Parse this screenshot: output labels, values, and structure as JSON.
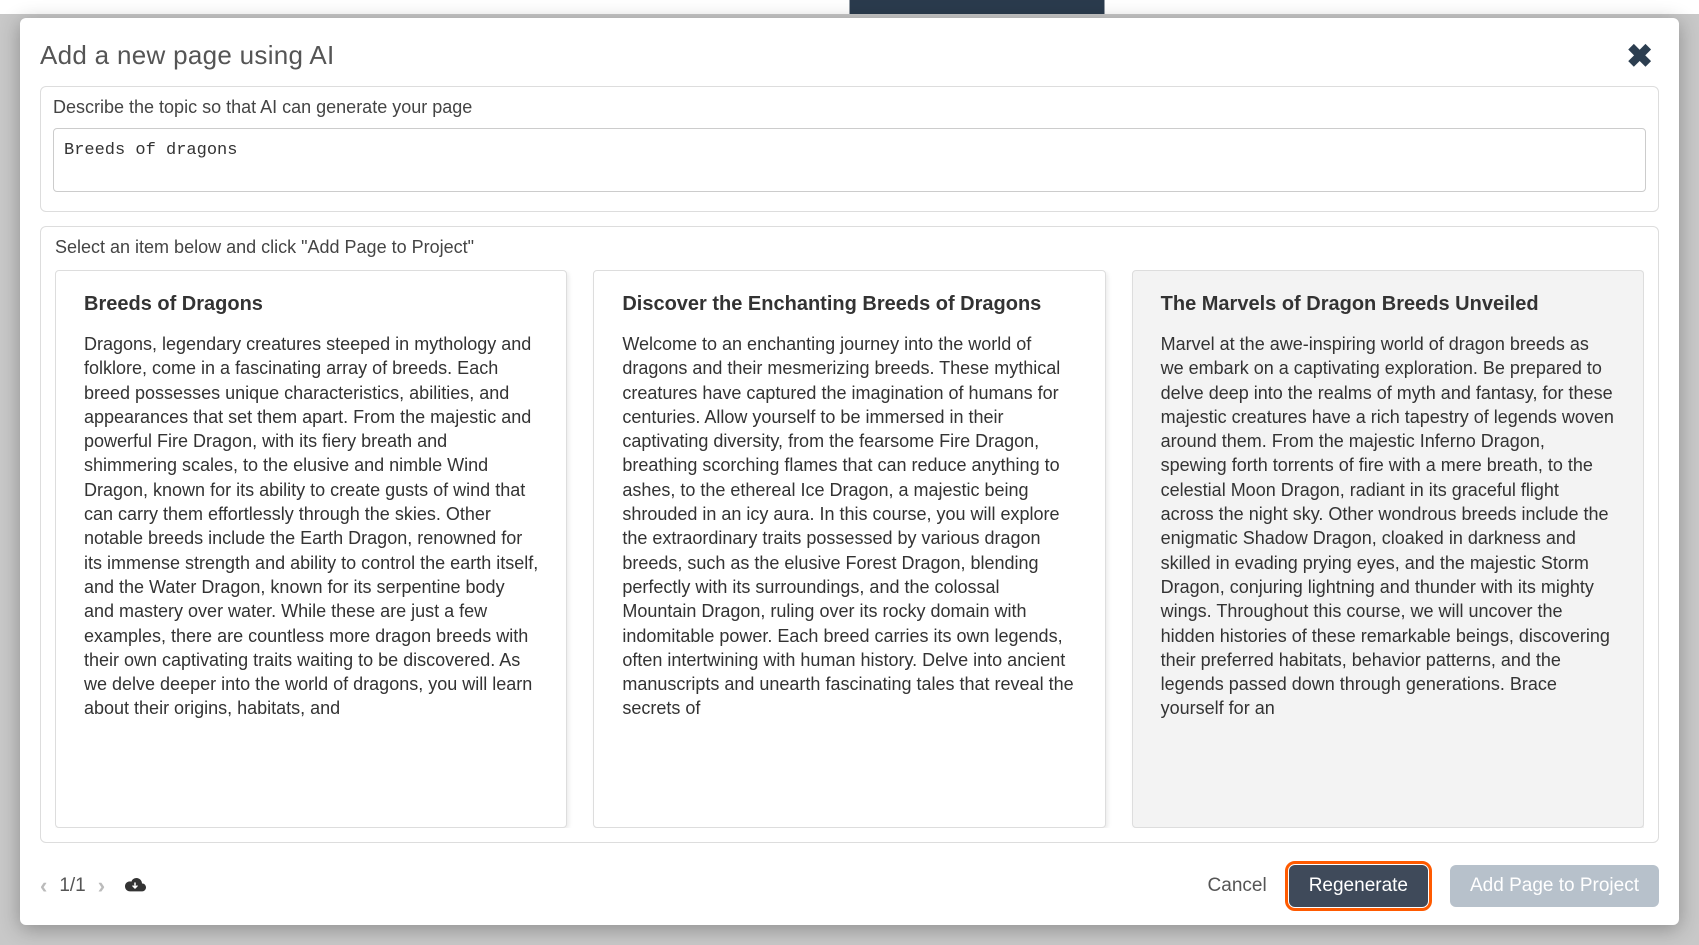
{
  "modal": {
    "title": "Add a new page using AI",
    "describe_label": "Describe the topic so that AI can generate your page",
    "describe_value": "Breeds of dragons",
    "select_label": "Select an item below and click \"Add Page to Project\""
  },
  "cards": [
    {
      "title": "Breeds of Dragons",
      "body": "Dragons, legendary creatures steeped in mythology and folklore, come in a fascinating array of breeds. Each breed possesses unique characteristics, abilities, and appearances that set them apart. From the majestic and powerful Fire Dragon, with its fiery breath and shimmering scales, to the elusive and nimble Wind Dragon, known for its ability to create gusts of wind that can carry them effortlessly through the skies. Other notable breeds include the Earth Dragon, renowned for its immense strength and ability to control the earth itself, and the Water Dragon, known for its serpentine body and mastery over water. While these are just a few examples, there are countless more dragon breeds with their own captivating traits waiting to be discovered. As we delve deeper into the world of dragons, you will learn about their origins, habitats, and",
      "selected": false
    },
    {
      "title": "Discover the Enchanting Breeds of Dragons",
      "body": "Welcome to an enchanting journey into the world of dragons and their mesmerizing breeds. These mythical creatures have captured the imagination of humans for centuries. Allow yourself to be immersed in their captivating diversity, from the fearsome Fire Dragon, breathing scorching flames that can reduce anything to ashes, to the ethereal Ice Dragon, a majestic being shrouded in an icy aura. In this course, you will explore the extraordinary traits possessed by various dragon breeds, such as the elusive Forest Dragon, blending perfectly with its surroundings, and the colossal Mountain Dragon, ruling over its rocky domain with indomitable power. Each breed carries its own legends, often intertwining with human history. Delve into ancient manuscripts and unearth fascinating tales that reveal the secrets of",
      "selected": false
    },
    {
      "title": "The Marvels of Dragon Breeds Unveiled",
      "body": "Marvel at the awe-inspiring world of dragon breeds as we embark on a captivating exploration. Be prepared to delve deep into the realms of myth and fantasy, for these majestic creatures have a rich tapestry of legends woven around them. From the majestic Inferno Dragon, spewing forth torrents of fire with a mere breath, to the celestial Moon Dragon, radiant in its graceful flight across the night sky. Other wondrous breeds include the enigmatic Shadow Dragon, cloaked in darkness and skilled in evading prying eyes, and the majestic Storm Dragon, conjuring lightning and thunder with its mighty wings. Throughout this course, we will uncover the hidden histories of these remarkable beings, discovering their preferred habitats, behavior patterns, and the legends passed down through generations. Brace yourself for an",
      "selected": true
    }
  ],
  "footer": {
    "page_indicator": "1/1",
    "cancel_label": "Cancel",
    "regenerate_label": "Regenerate",
    "add_label": "Add Page to Project"
  }
}
